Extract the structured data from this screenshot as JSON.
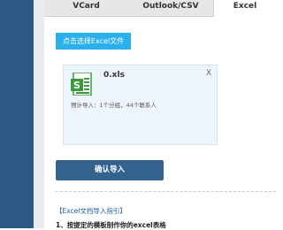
{
  "tabs": [
    {
      "label": "VCard"
    },
    {
      "label": "Outlook/CSV"
    },
    {
      "label": "Excel"
    }
  ],
  "choose_button": "点击选择Excel文件",
  "file": {
    "name": "0.xls",
    "info": "预计导入：1个分组，44个联系人",
    "close": "X"
  },
  "confirm_button": "确认导入",
  "guide": {
    "title": "【Excel文档导入指引】",
    "step1": "1、按提定的模板制作你的excel表格"
  },
  "colors": {
    "sidebar": "#2d5785",
    "choose_button": "#2bb0ee",
    "confirm_button": "#34628f",
    "excel_icon": "#3c9a3c"
  }
}
